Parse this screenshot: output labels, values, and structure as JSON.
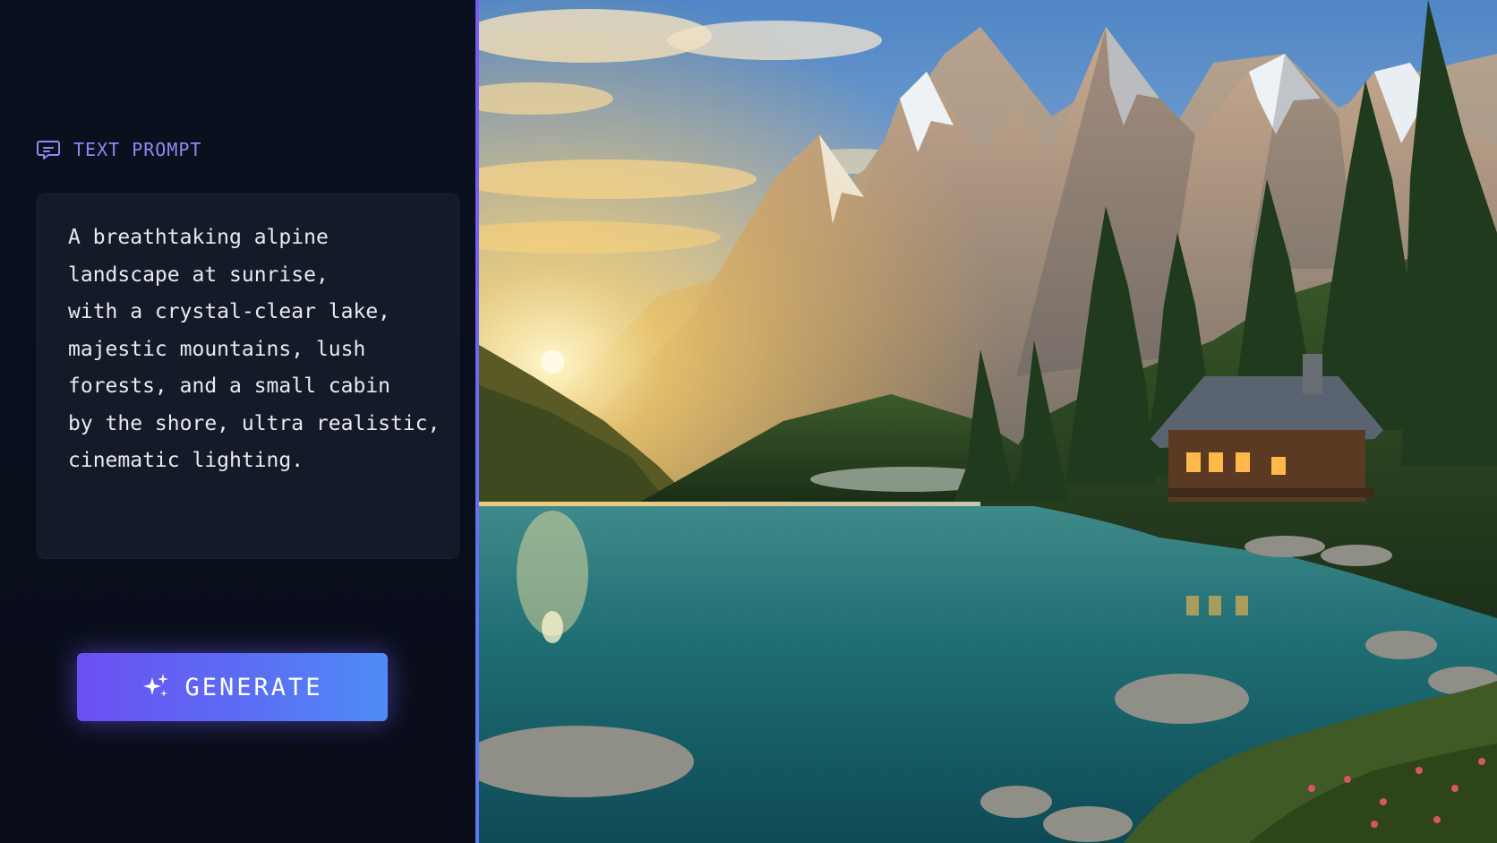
{
  "prompt": {
    "header_label": "TEXT PROMPT",
    "header_icon": "chat-bubble-icon",
    "lines": [
      "A breathtaking alpine",
      "landscape at sunrise,",
      "with a crystal-clear lake,",
      "majestic mountains, lush",
      "forests, and a small cabin",
      "by the shore, ultra realistic,",
      "cinematic lighting."
    ]
  },
  "generate": {
    "label": "GENERATE",
    "icon": "sparkles-icon"
  },
  "colors": {
    "accent": "#7c5cf0",
    "accent_secondary": "#4f8cf6",
    "panel_bg": "#0b1020",
    "prompt_box_bg": "#151a28",
    "header_label": "#8b8cf2"
  }
}
